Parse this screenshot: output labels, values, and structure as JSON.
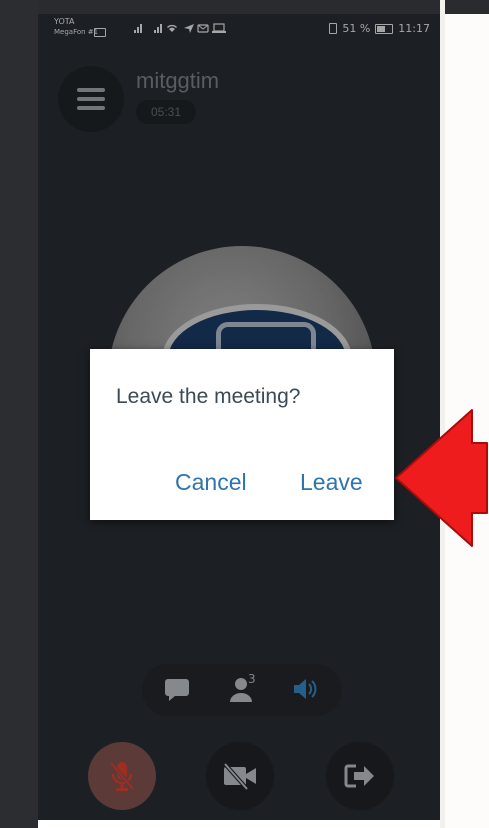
{
  "status_bar": {
    "carrier_primary": "YOTA",
    "carrier_secondary": "MegaFon #1",
    "battery_percent": "51 %",
    "time": "11:17"
  },
  "header": {
    "title": "mitggtim",
    "timer": "05:31"
  },
  "dialog": {
    "title": "Leave the meeting?",
    "cancel_label": "Cancel",
    "leave_label": "Leave"
  },
  "toolbar": {
    "participants_count": "3"
  },
  "colors": {
    "background": "#23272b",
    "accent": "#2f74aa",
    "arrow": "#ee1c1c",
    "mic_muted": "#c0392b"
  },
  "icons": {
    "menu": "hamburger-menu-icon",
    "chat": "chat-bubble-icon",
    "participants": "person-icon",
    "speaker": "speaker-icon",
    "mic": "mic-muted-icon",
    "video": "video-off-icon",
    "exit": "exit-icon"
  }
}
